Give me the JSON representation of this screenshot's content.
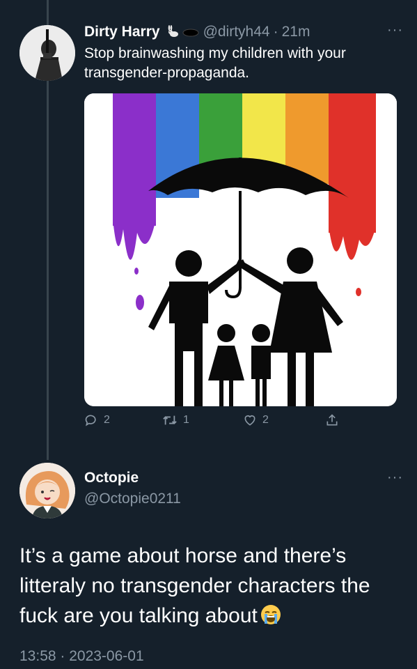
{
  "tweet1": {
    "name": "Dirty Harry",
    "handle": "@dirtyh44",
    "separator": "·",
    "time": "21m",
    "text": "Stop brainwashing my children with your transgender-propaganda.",
    "more": "···",
    "badges": [
      "rabbit-emoji",
      "hole-emoji"
    ],
    "actions": {
      "replies": "2",
      "retweets": "1",
      "likes": "2"
    }
  },
  "tweet2": {
    "name": "Octopie",
    "handle": "@Octopie0211",
    "more": "···",
    "text": "It’s a game about horse and there’s litteraly no transgender characters the fuck are you talking about",
    "emoji": "loudly-crying-face",
    "timestamp": "13:58 · 2023-06-01"
  },
  "colors": {
    "background": "#15202b",
    "secondary_text": "#8b98a5",
    "rainbow": [
      "#8b2fc9",
      "#3b78d6",
      "#3aa03a",
      "#f2e64a",
      "#ef9a2d",
      "#e0312a"
    ]
  }
}
